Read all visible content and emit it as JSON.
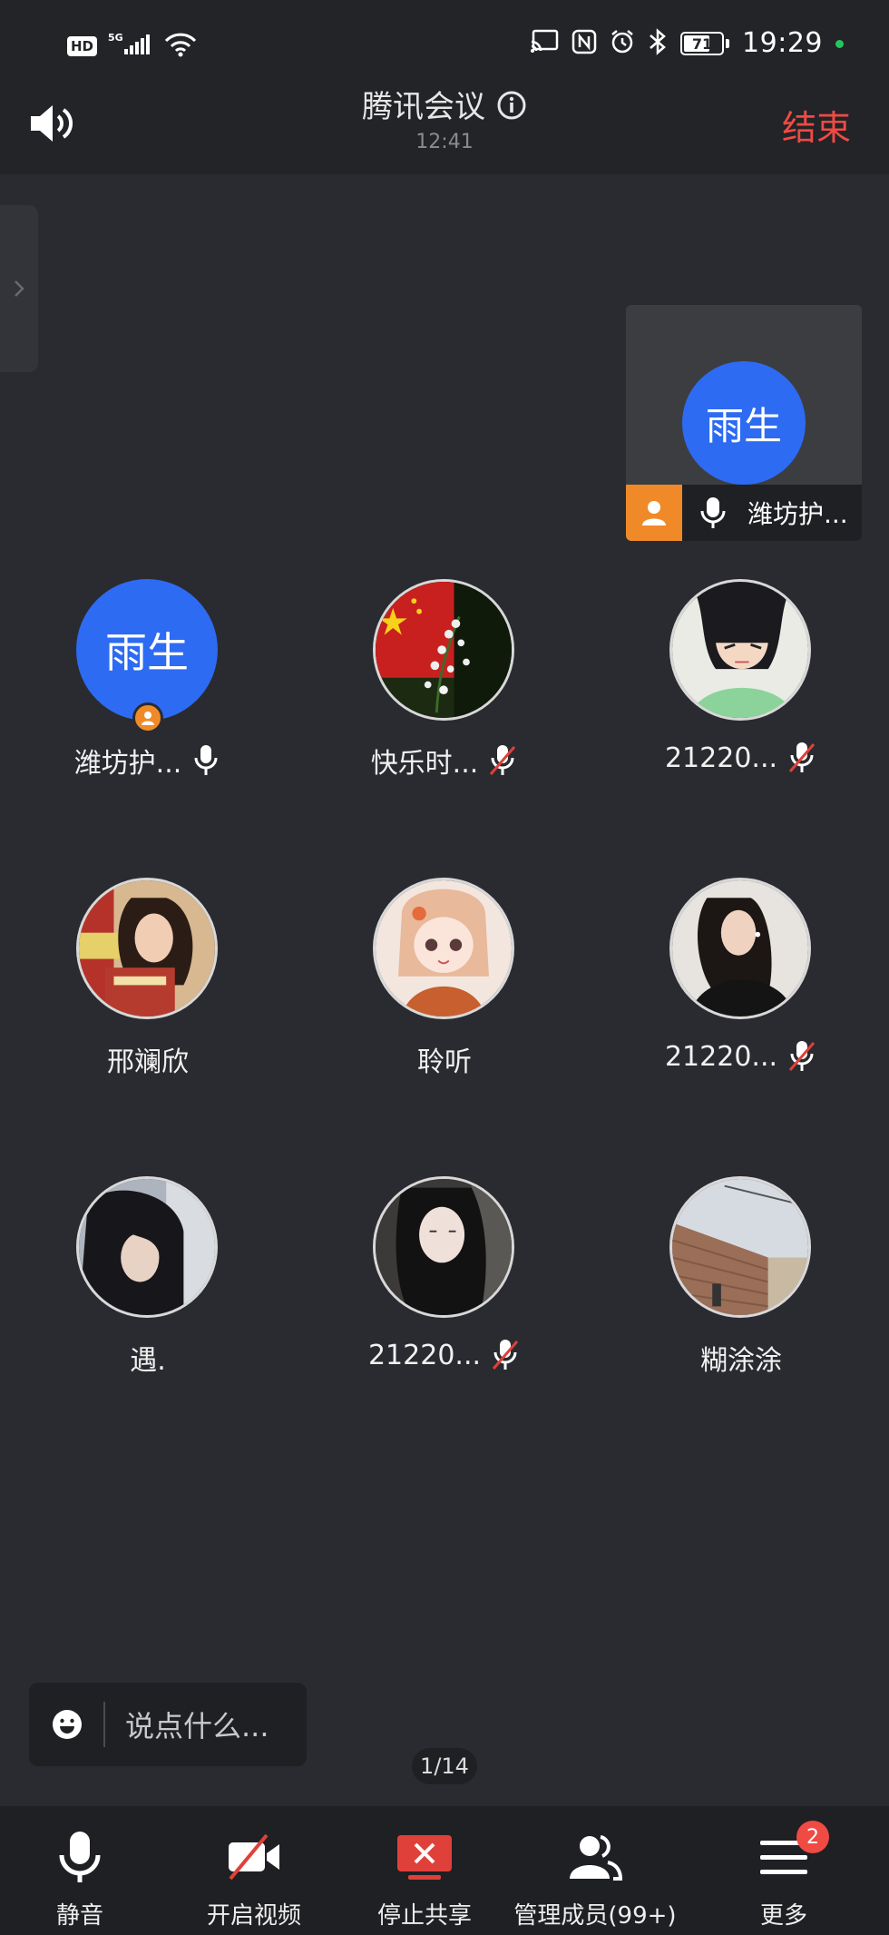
{
  "status_bar": {
    "hd": "HD",
    "signal": "5G",
    "time": "19:29",
    "battery": "71",
    "battery_level_pct": 71
  },
  "header": {
    "title": "腾讯会议",
    "duration": "12:41",
    "end_label": "结束"
  },
  "self_tile": {
    "avatar_text": "雨生",
    "name": "潍坊护..."
  },
  "participants": [
    {
      "name": "潍坊护...",
      "avatar_text": "雨生",
      "avatar": "blue-text",
      "host": true,
      "mic": "on"
    },
    {
      "name": "快乐时...",
      "avatar": "flag-flowers-photo",
      "host": false,
      "mic": "muted"
    },
    {
      "name": "21220...",
      "avatar": "anime-boy-photo",
      "host": false,
      "mic": "muted"
    },
    {
      "name": "邢斓欣",
      "avatar": "girl-books-photo",
      "host": false,
      "mic": "none"
    },
    {
      "name": "聆听",
      "avatar": "anime-girl-photo",
      "host": false,
      "mic": "none"
    },
    {
      "name": "21220...",
      "avatar": "woman-dark-photo",
      "host": false,
      "mic": "muted"
    },
    {
      "name": "遇.",
      "avatar": "girl-hair-photo",
      "host": false,
      "mic": "none"
    },
    {
      "name": "21220...",
      "avatar": "girl-car-photo",
      "host": false,
      "mic": "muted"
    },
    {
      "name": "糊涂涂",
      "avatar": "brick-wall-photo",
      "host": false,
      "mic": "none"
    }
  ],
  "chat": {
    "placeholder": "说点什么..."
  },
  "pager": "1/14",
  "toolbar": {
    "mute": "静音",
    "video": "开启视频",
    "share": "停止共享",
    "members": "管理成员(99+)",
    "more": "更多",
    "more_badge": "2"
  },
  "colors": {
    "background": "#2a2b30",
    "accent_blue": "#2e6bf3",
    "end_red": "#f04a44",
    "host_orange": "#f08a28",
    "mute_red": "#e0403a"
  }
}
